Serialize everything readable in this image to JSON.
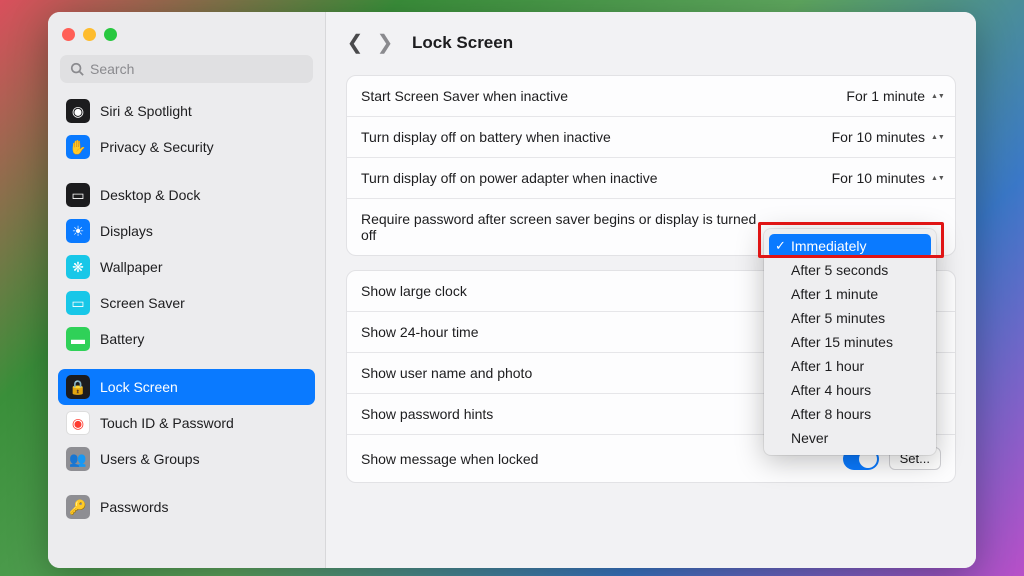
{
  "search": {
    "placeholder": "Search"
  },
  "sidebar": {
    "items": [
      {
        "label": "Siri & Spotlight",
        "iconBg": "#1c1c1e",
        "selected": false
      },
      {
        "label": "Privacy & Security",
        "iconBg": "#0a7aff",
        "selected": false
      },
      {
        "spacer": true
      },
      {
        "label": "Desktop & Dock",
        "iconBg": "#1c1c1e",
        "selected": false
      },
      {
        "label": "Displays",
        "iconBg": "#0a7aff",
        "selected": false
      },
      {
        "label": "Wallpaper",
        "iconBg": "#18c7e8",
        "selected": false
      },
      {
        "label": "Screen Saver",
        "iconBg": "#18c7e8",
        "selected": false
      },
      {
        "label": "Battery",
        "iconBg": "#2fd158",
        "selected": false
      },
      {
        "spacer": true
      },
      {
        "label": "Lock Screen",
        "iconBg": "#1c1c1e",
        "selected": true
      },
      {
        "label": "Touch ID & Password",
        "iconBg": "#ffffff",
        "selected": false
      },
      {
        "label": "Users & Groups",
        "iconBg": "#8e8e93",
        "selected": false
      },
      {
        "spacer": true
      },
      {
        "label": "Passwords",
        "iconBg": "#8e8e93",
        "selected": false
      }
    ]
  },
  "header": {
    "title": "Lock Screen"
  },
  "group1": {
    "row1": {
      "label": "Start Screen Saver when inactive",
      "value": "For 1 minute"
    },
    "row2": {
      "label": "Turn display off on battery when inactive",
      "value": "For 10 minutes"
    },
    "row3": {
      "label": "Turn display off on power adapter when inactive",
      "value": "For 10 minutes"
    },
    "row4": {
      "label": "Require password after screen saver begins or display is turned off",
      "value": "Immediately"
    }
  },
  "group2": {
    "row1": {
      "label": "Show large clock"
    },
    "row2": {
      "label": "Show 24-hour time"
    },
    "row3": {
      "label": "Show user name and photo"
    },
    "row4": {
      "label": "Show password hints"
    },
    "row5": {
      "label": "Show message when locked",
      "button": "Set..."
    }
  },
  "dropdown": {
    "items": [
      "Immediately",
      "After 5 seconds",
      "After 1 minute",
      "After 5 minutes",
      "After 15 minutes",
      "After 1 hour",
      "After 4 hours",
      "After 8 hours",
      "Never"
    ],
    "selectedIndex": 0
  },
  "icons": {
    "siri": "◉",
    "privacy": "✋",
    "desktop": "▭",
    "displays": "☀",
    "wallpaper": "❋",
    "screensaver": "▭",
    "battery": "▬",
    "lock": "🔒",
    "touchid": "◉",
    "users": "👥",
    "passwords": "🔑"
  }
}
